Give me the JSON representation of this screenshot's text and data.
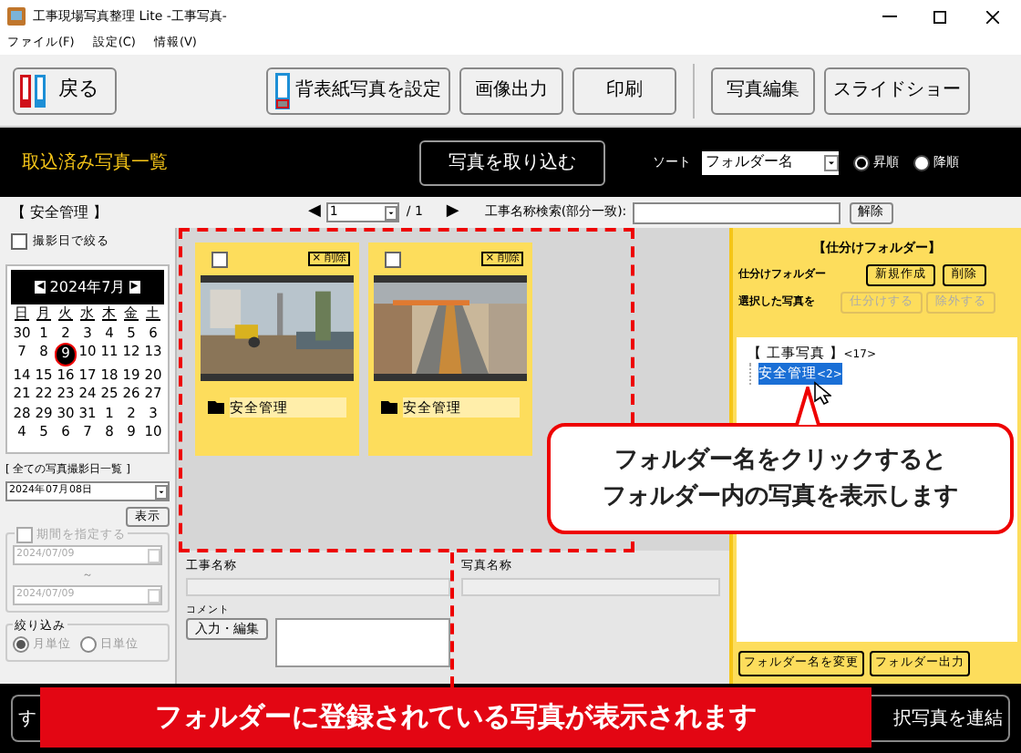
{
  "window": {
    "title": "工事現場写真整理 Lite -工事写真-"
  },
  "menu": [
    "ファイル(F)",
    "設定(C)",
    "情報(V)"
  ],
  "toolbar": {
    "back": "戻る",
    "buttons": [
      {
        "label": "背表紙写真を設定",
        "kind": "spine"
      },
      {
        "label": "画像出力",
        "kind": "plain"
      },
      {
        "label": "印刷",
        "kind": "plain"
      },
      {
        "label": "写真編集",
        "kind": "plain"
      },
      {
        "label": "スライドショー",
        "kind": "plain"
      }
    ]
  },
  "header": {
    "title": "取込済み写真一覧",
    "import_button": "写真を取り込む",
    "sort_label": "ソート",
    "sort_value": "フォルダー名",
    "orders": [
      {
        "label": "昇順",
        "selected": true
      },
      {
        "label": "降順",
        "selected": false
      }
    ]
  },
  "subbar": {
    "folder": "【 安全管理 】",
    "prev": "◀",
    "page": "1",
    "of": "/ 1",
    "next": "▶",
    "search_label": "工事名称検索(部分一致):",
    "clear": "解除"
  },
  "left": {
    "filter": {
      "label": "撮影日で絞る",
      "checked": false
    },
    "calendar": {
      "prev": "◀",
      "month": "2024年7月",
      "next": "▶",
      "weekdays": [
        "日",
        "月",
        "火",
        "水",
        "木",
        "金",
        "土"
      ],
      "weeks": [
        [
          {
            "d": "30",
            "selected": false
          },
          {
            "d": "1",
            "selected": false
          },
          {
            "d": "2",
            "selected": false
          },
          {
            "d": "3",
            "selected": false
          },
          {
            "d": "4",
            "selected": false
          },
          {
            "d": "5",
            "selected": false
          },
          {
            "d": "6",
            "selected": false
          }
        ],
        [
          {
            "d": "7",
            "selected": false
          },
          {
            "d": "8",
            "selected": false
          },
          {
            "d": "9",
            "selected": true
          },
          {
            "d": "10",
            "selected": false
          },
          {
            "d": "11",
            "selected": false
          },
          {
            "d": "12",
            "selected": false
          },
          {
            "d": "13",
            "selected": false
          }
        ],
        [
          {
            "d": "14",
            "selected": false
          },
          {
            "d": "15",
            "selected": false
          },
          {
            "d": "16",
            "selected": false
          },
          {
            "d": "17",
            "selected": false
          },
          {
            "d": "18",
            "selected": false
          },
          {
            "d": "19",
            "selected": false
          },
          {
            "d": "20",
            "selected": false
          }
        ],
        [
          {
            "d": "21",
            "selected": false
          },
          {
            "d": "22",
            "selected": false
          },
          {
            "d": "23",
            "selected": false
          },
          {
            "d": "24",
            "selected": false
          },
          {
            "d": "25",
            "selected": false
          },
          {
            "d": "26",
            "selected": false
          },
          {
            "d": "27",
            "selected": false
          }
        ],
        [
          {
            "d": "28",
            "selected": false
          },
          {
            "d": "29",
            "selected": false
          },
          {
            "d": "30",
            "selected": false
          },
          {
            "d": "31",
            "selected": false
          },
          {
            "d": "1",
            "selected": false
          },
          {
            "d": "2",
            "selected": false
          },
          {
            "d": "3",
            "selected": false
          }
        ],
        [
          {
            "d": "4",
            "selected": false
          },
          {
            "d": "5",
            "selected": false
          },
          {
            "d": "6",
            "selected": false
          },
          {
            "d": "7",
            "selected": false
          },
          {
            "d": "8",
            "selected": false
          },
          {
            "d": "9",
            "selected": false
          },
          {
            "d": "10",
            "selected": false
          }
        ]
      ]
    },
    "all_dates_label": "[ 全ての写真撮影日一覧 ]",
    "date_value": "2024年07月08日",
    "show": "表示",
    "period": {
      "label": "期間を指定する",
      "checked": false,
      "disabled": true,
      "from": "2024/07/09",
      "tilde": "～",
      "to": "2024/07/09"
    },
    "narrow": {
      "label": "絞り込み",
      "options": [
        {
          "label": "月単位",
          "selected": true
        },
        {
          "label": "日単位",
          "selected": false
        }
      ]
    }
  },
  "photos": [
    {
      "checked": false,
      "delete": "× 削除",
      "folder": "安全管理",
      "kind": "picture"
    },
    {
      "checked": false,
      "delete": "× 削除",
      "folder": "安全管理",
      "kind": "picture"
    }
  ],
  "details": {
    "project_label": "工事名称",
    "photo_label": "写真名称",
    "comment_label": "コメント",
    "edit": "入力・編集"
  },
  "sorting": {
    "title": "【仕分けフォルダー】",
    "folder_label": "仕分けフォルダー",
    "new": "新規作成",
    "delete": "削除",
    "selected_label": "選択した写真を",
    "assign": "仕分けする",
    "exclude": "除外する",
    "tree": [
      {
        "label": "【 工事写真 】",
        "count": "<17>",
        "selected": false,
        "children": [
          {
            "label": "安全管理",
            "count": "<2>",
            "selected": true
          }
        ]
      }
    ],
    "rename": "フォルダー名を変更",
    "export": "フォルダー出力"
  },
  "bottom": {
    "left": "す",
    "right": "択写真を連結"
  },
  "callouts": {
    "bubble": [
      "フォルダー名をクリックすると",
      "フォルダー内の写真を表示します"
    ],
    "banner": "フォルダーに登録されている写真が表示されます"
  }
}
